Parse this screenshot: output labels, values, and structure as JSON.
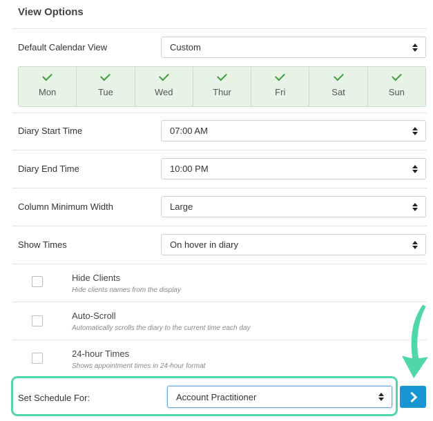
{
  "title": "View Options",
  "default_view": {
    "label": "Default Calendar View",
    "value": "Custom"
  },
  "days": [
    {
      "name": "Mon",
      "checked": true
    },
    {
      "name": "Tue",
      "checked": true
    },
    {
      "name": "Wed",
      "checked": true
    },
    {
      "name": "Thur",
      "checked": true
    },
    {
      "name": "Fri",
      "checked": true
    },
    {
      "name": "Sat",
      "checked": true
    },
    {
      "name": "Sun",
      "checked": true
    }
  ],
  "start_time": {
    "label": "Diary Start Time",
    "value": "07:00 AM"
  },
  "end_time": {
    "label": "Diary End Time",
    "value": "10:00 PM"
  },
  "col_width": {
    "label": "Column Minimum Width",
    "value": "Large"
  },
  "show_times": {
    "label": "Show Times",
    "value": "On hover in diary"
  },
  "options": [
    {
      "title": "Hide Clients",
      "desc": "Hide clients names from the display",
      "checked": false
    },
    {
      "title": "Auto-Scroll",
      "desc": "Automatically scrolls the diary to the current time each day",
      "checked": false
    },
    {
      "title": "24-hour Times",
      "desc": "Shows appointment times in 24-hour format",
      "checked": false
    }
  ],
  "schedule": {
    "label": "Set Schedule For:",
    "value": "Account Practitioner"
  },
  "colors": {
    "day_bg": "#e6f3e6",
    "check": "#3a9d3a",
    "highlight": "#4fd6aa",
    "go_button": "#1895d3"
  },
  "icons": {
    "check": "check-icon",
    "select_arrows": "select-arrows-icon",
    "go": "chevron-right-icon",
    "pointer_arrow": "curved-arrow-icon"
  }
}
